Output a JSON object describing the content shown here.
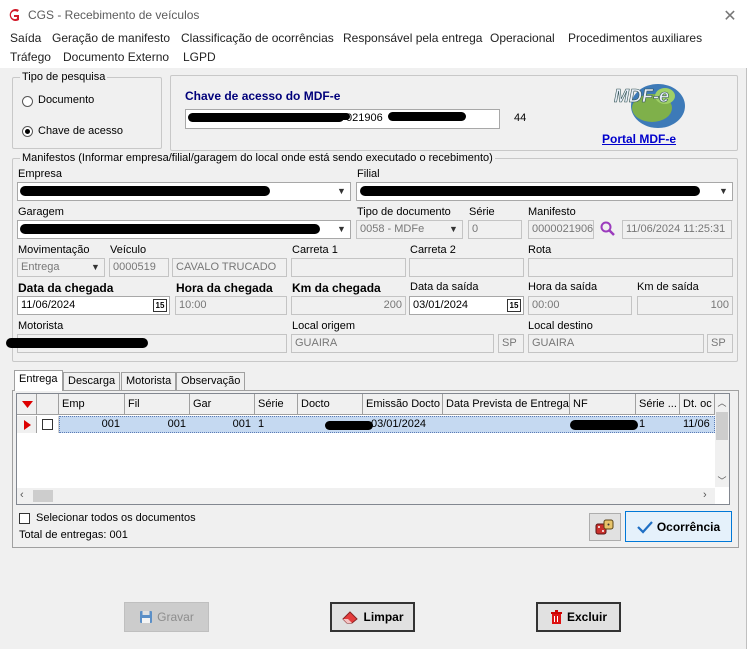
{
  "window": {
    "title": "CGS - Recebimento de veículos",
    "close": "✕"
  },
  "menu": [
    "Saída",
    "Geração de manifesto",
    "Classificação de ocorrências",
    "Responsável pela entrega",
    "Operacional",
    "Procedimentos auxiliares",
    "Tráfego",
    "Documento Externo",
    "LGPD"
  ],
  "search_type": {
    "title": "Tipo de pesquisa",
    "option_document": "Documento",
    "option_key": "Chave de acesso",
    "selected": "Chave de acesso"
  },
  "mdfe": {
    "label": "Chave de acesso do MDF-e",
    "key_visible": "021906",
    "digits": "44",
    "portal_link": "Portal MDF-e",
    "logo_text": "MDF-e"
  },
  "manifests": {
    "title": "Manifestos (Informar empresa/filial/garagem do local onde está sendo executado o recebimento)",
    "empresa_label": "Empresa",
    "filial_label": "Filial",
    "garagem_label": "Garagem",
    "tipo_doc_label": "Tipo de documento",
    "tipo_doc_value": "0058 - MDFe",
    "serie_label": "Série",
    "serie_value": "0",
    "manifesto_label": "Manifesto",
    "manifesto_value": "0000021906",
    "manifesto_datetime": "11/06/2024 11:25:31",
    "movimentacao_label": "Movimentação",
    "movimentacao_value": "Entrega",
    "veiculo_label": "Veículo",
    "veiculo_code": "0000519",
    "veiculo_desc": "CAVALO TRUCADO",
    "carreta1_label": "Carreta 1",
    "carreta2_label": "Carreta 2",
    "rota_label": "Rota",
    "data_chegada_label": "Data da chegada",
    "data_chegada_value": "11/06/2024",
    "hora_chegada_label": "Hora da chegada",
    "hora_chegada_value": "10:00",
    "km_chegada_label": "Km da chegada",
    "km_chegada_value": "200",
    "data_saida_label": "Data da saída",
    "data_saida_value": "03/01/2024",
    "hora_saida_label": "Hora da saída",
    "hora_saida_value": "00:00",
    "km_saida_label": "Km de saída",
    "km_saida_value": "100",
    "motorista_label": "Motorista",
    "local_origem_label": "Local origem",
    "local_origem_city": "GUAIRA",
    "local_origem_uf": "SP",
    "local_destino_label": "Local destino",
    "local_destino_city": "GUAIRA",
    "local_destino_uf": "SP",
    "calendar_icon": "15"
  },
  "tabs": [
    "Entrega",
    "Descarga",
    "Motorista",
    "Observação"
  ],
  "grid": {
    "headers": [
      "Emp",
      "Fil",
      "Gar",
      "Série",
      "Docto",
      "Emissão Docto",
      "Data Prevista de Entrega",
      "NF",
      "Série ...",
      "Dt. oc"
    ],
    "row": {
      "emp": "001",
      "fil": "001",
      "gar": "001",
      "serie": "1",
      "emissao": "03/01/2024",
      "nf_serie": "1",
      "dt_oc": "11/06"
    }
  },
  "select_all_label": "Selecionar todos os documentos",
  "total_label": "Total de entregas: 001",
  "buttons": {
    "ocorrencia": "Ocorrência",
    "gravar": "Gravar",
    "limpar": "Limpar",
    "excluir": "Excluir"
  }
}
